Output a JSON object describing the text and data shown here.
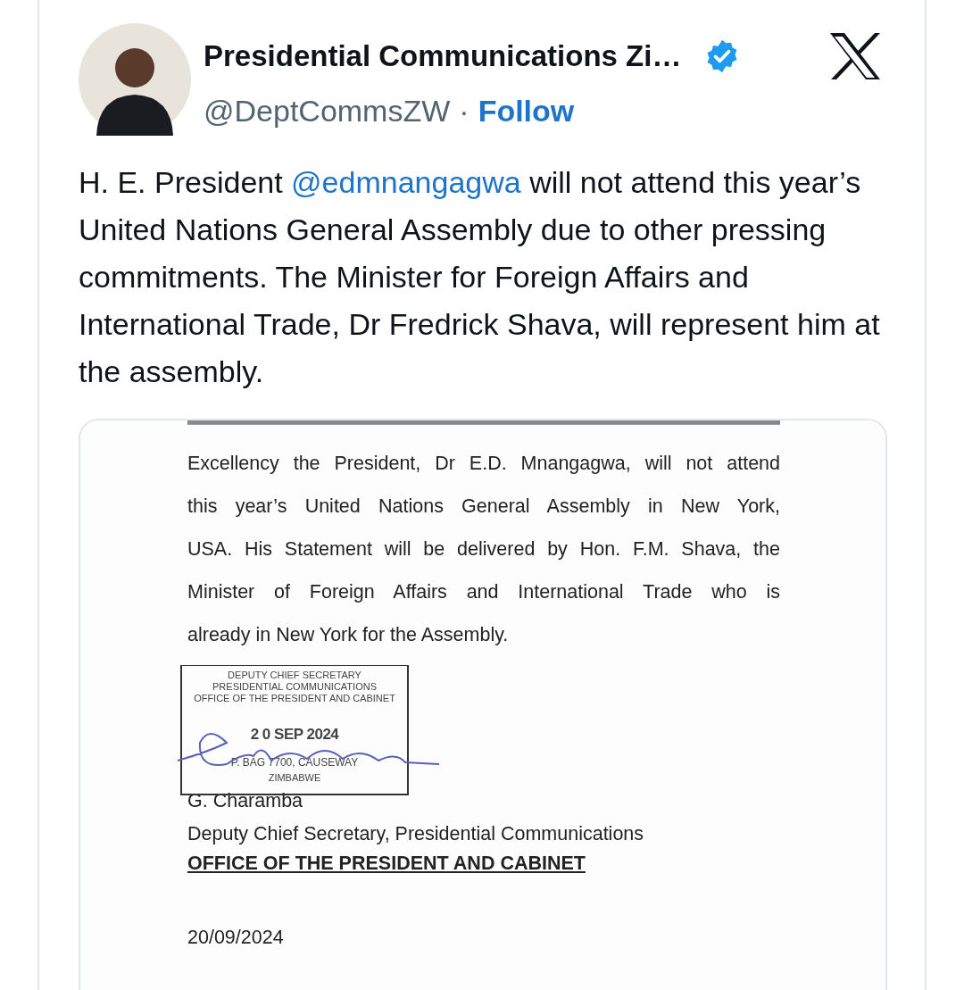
{
  "tweet": {
    "author_name": "Presidential Communications Zi…",
    "verified": true,
    "handle": "@DeptCommsZW",
    "separator": "·",
    "follow": "Follow",
    "text_before": "H. E. President ",
    "mention": "@edmnangagwa",
    "text_after": " will not attend this year’s United Nations General Assembly due to other pressing commitments. The Minister for Foreign Affairs and International Trade, Dr Fredrick Shava, will represent him at the assembly.",
    "document": {
      "lines": [
        "Excellency the President, Dr E.D. Mnangagwa, will not attend",
        "this year’s United Nations General Assembly in New York,",
        "USA.  His Statement will be delivered by Hon. F.M. Shava, the",
        "Minister of Foreign Affairs and International Trade who is",
        "already in New York for the Assembly."
      ],
      "stamp": {
        "lines": [
          "DEPUTY CHIEF SECRETARY",
          "PRESIDENTIAL COMMUNICATIONS",
          "OFFICE OF THE PRESIDENT AND CABINET"
        ],
        "date": "2 0 SEP 2024",
        "address": "P. BAG 7700, CAUSEWAY",
        "country": "ZIMBABWE"
      },
      "signatory": "G. Charamba",
      "position": "Deputy Chief Secretary, Presidential Communications",
      "office": "OFFICE OF THE PRESIDENT AND CABINET",
      "date": "20/09/2024"
    }
  }
}
